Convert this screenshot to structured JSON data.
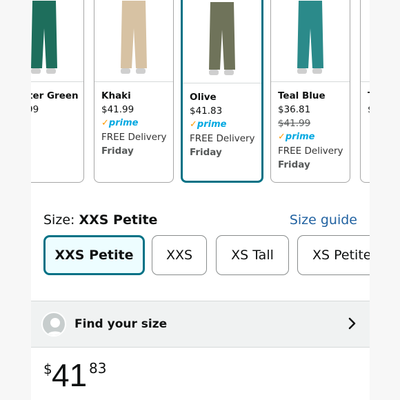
{
  "swatches": [
    {
      "name": "ter Green",
      "price": "99",
      "pants_color": "#1e6e5c"
    },
    {
      "name": "Khaki",
      "price": "$41.99",
      "prime": "prime",
      "delivery": "FREE Delivery",
      "day": "Friday",
      "pants_color": "#d7c2a3"
    },
    {
      "name": "Olive",
      "price": "$41.83",
      "prime": "prime",
      "delivery": "FREE Delivery",
      "day": "Friday",
      "pants_color": "#6f735a"
    },
    {
      "name": "Teal Blue",
      "price": "$36.81",
      "old_price": "$41.99",
      "prime": "prime",
      "delivery": "FREE Delivery",
      "day": "Friday",
      "pants_color": "#2b8a8a"
    },
    {
      "name": "T",
      "price": "$"
    }
  ],
  "size": {
    "label": "Size: ",
    "selected_value": "XXS Petite",
    "guide_link": "Size guide",
    "options": [
      "XXS Petite",
      "XXS",
      "XS Tall",
      "XS Petite"
    ]
  },
  "find_size": {
    "label": "Find your size"
  },
  "price": {
    "symbol": "$",
    "whole": "41",
    "fraction": "83"
  },
  "colors": {
    "selected_border": "#007185",
    "link": "#2162a1",
    "prime": "#00a8e1"
  }
}
